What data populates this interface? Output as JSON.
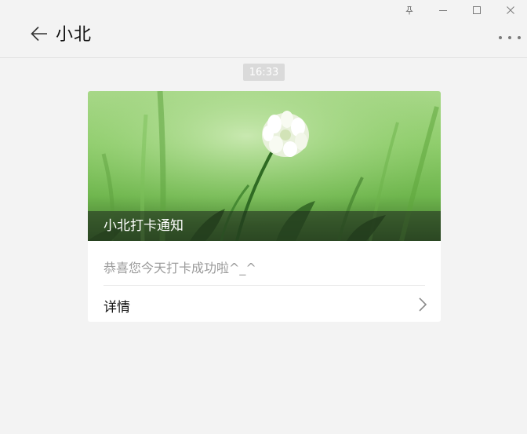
{
  "window_controls": [
    "pin-icon",
    "minimize-icon",
    "maximize-icon",
    "close-icon"
  ],
  "header": {
    "back_icon": "arrow-left-icon",
    "title": "小北",
    "more_icon": "more-dots-icon"
  },
  "timestamp": "16:33",
  "card": {
    "cover_image": "white-clover-flower-on-green-grass",
    "title": "小北打卡通知",
    "description": "恭喜您今天打卡成功啦^_^",
    "detail_label": "详情",
    "detail_icon": "chevron-right-icon"
  },
  "colors": {
    "background": "#f3f3f3",
    "card_background": "#ffffff",
    "timestamp_background": "#dadada",
    "description_text": "#9a9a9a"
  }
}
